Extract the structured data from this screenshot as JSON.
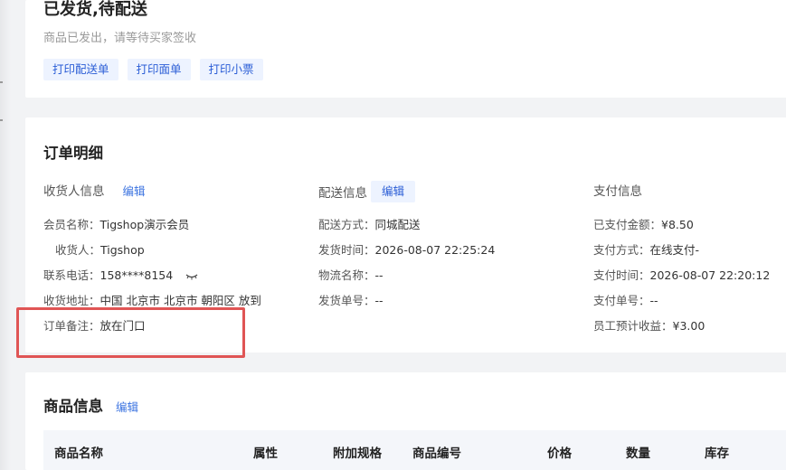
{
  "status": {
    "title": "已发货,待配送",
    "subtitle": "商品已发出，请等待买家签收",
    "actions": [
      "打印配送单",
      "打印面单",
      "打印小票"
    ]
  },
  "order": {
    "title": "订单明细",
    "receiver": {
      "heading": "收货人信息",
      "edit": "编辑",
      "rows": [
        {
          "label": "会员名称：",
          "value": "Tigshop演示会员"
        },
        {
          "label": "收货人：",
          "value": "Tigshop"
        },
        {
          "label": "联系电话：",
          "value": "158****8154"
        },
        {
          "label": "收货地址：",
          "value": "中国 北京市 北京市 朝阳区 放到"
        },
        {
          "label": "订单备注：",
          "value": "放在门口"
        }
      ]
    },
    "shipping": {
      "heading": "配送信息",
      "edit": "编辑",
      "rows": [
        {
          "label": "配送方式：",
          "value": "同城配送"
        },
        {
          "label": "发货时间：",
          "value": "2026-08-07 22:25:24"
        },
        {
          "label": "物流名称：",
          "value": "--"
        },
        {
          "label": "发货单号：",
          "value": "--"
        }
      ]
    },
    "payment": {
      "heading": "支付信息",
      "rows": [
        {
          "label": "已支付金额：",
          "value": "¥8.50"
        },
        {
          "label": "支付方式：",
          "value": "在线支付-"
        },
        {
          "label": "支付时间：",
          "value": "2026-08-07 22:20:12"
        },
        {
          "label": "支付单号：",
          "value": "--"
        },
        {
          "label": "员工预计收益：",
          "value": "¥3.00"
        }
      ]
    }
  },
  "goods": {
    "title": "商品信息",
    "edit": "编辑",
    "columns": [
      "商品名称",
      "属性",
      "附加规格",
      "商品编号",
      "价格",
      "数量",
      "库存"
    ]
  },
  "colors": {
    "accent": "#2a5dd6",
    "highlight": "#e05555"
  }
}
